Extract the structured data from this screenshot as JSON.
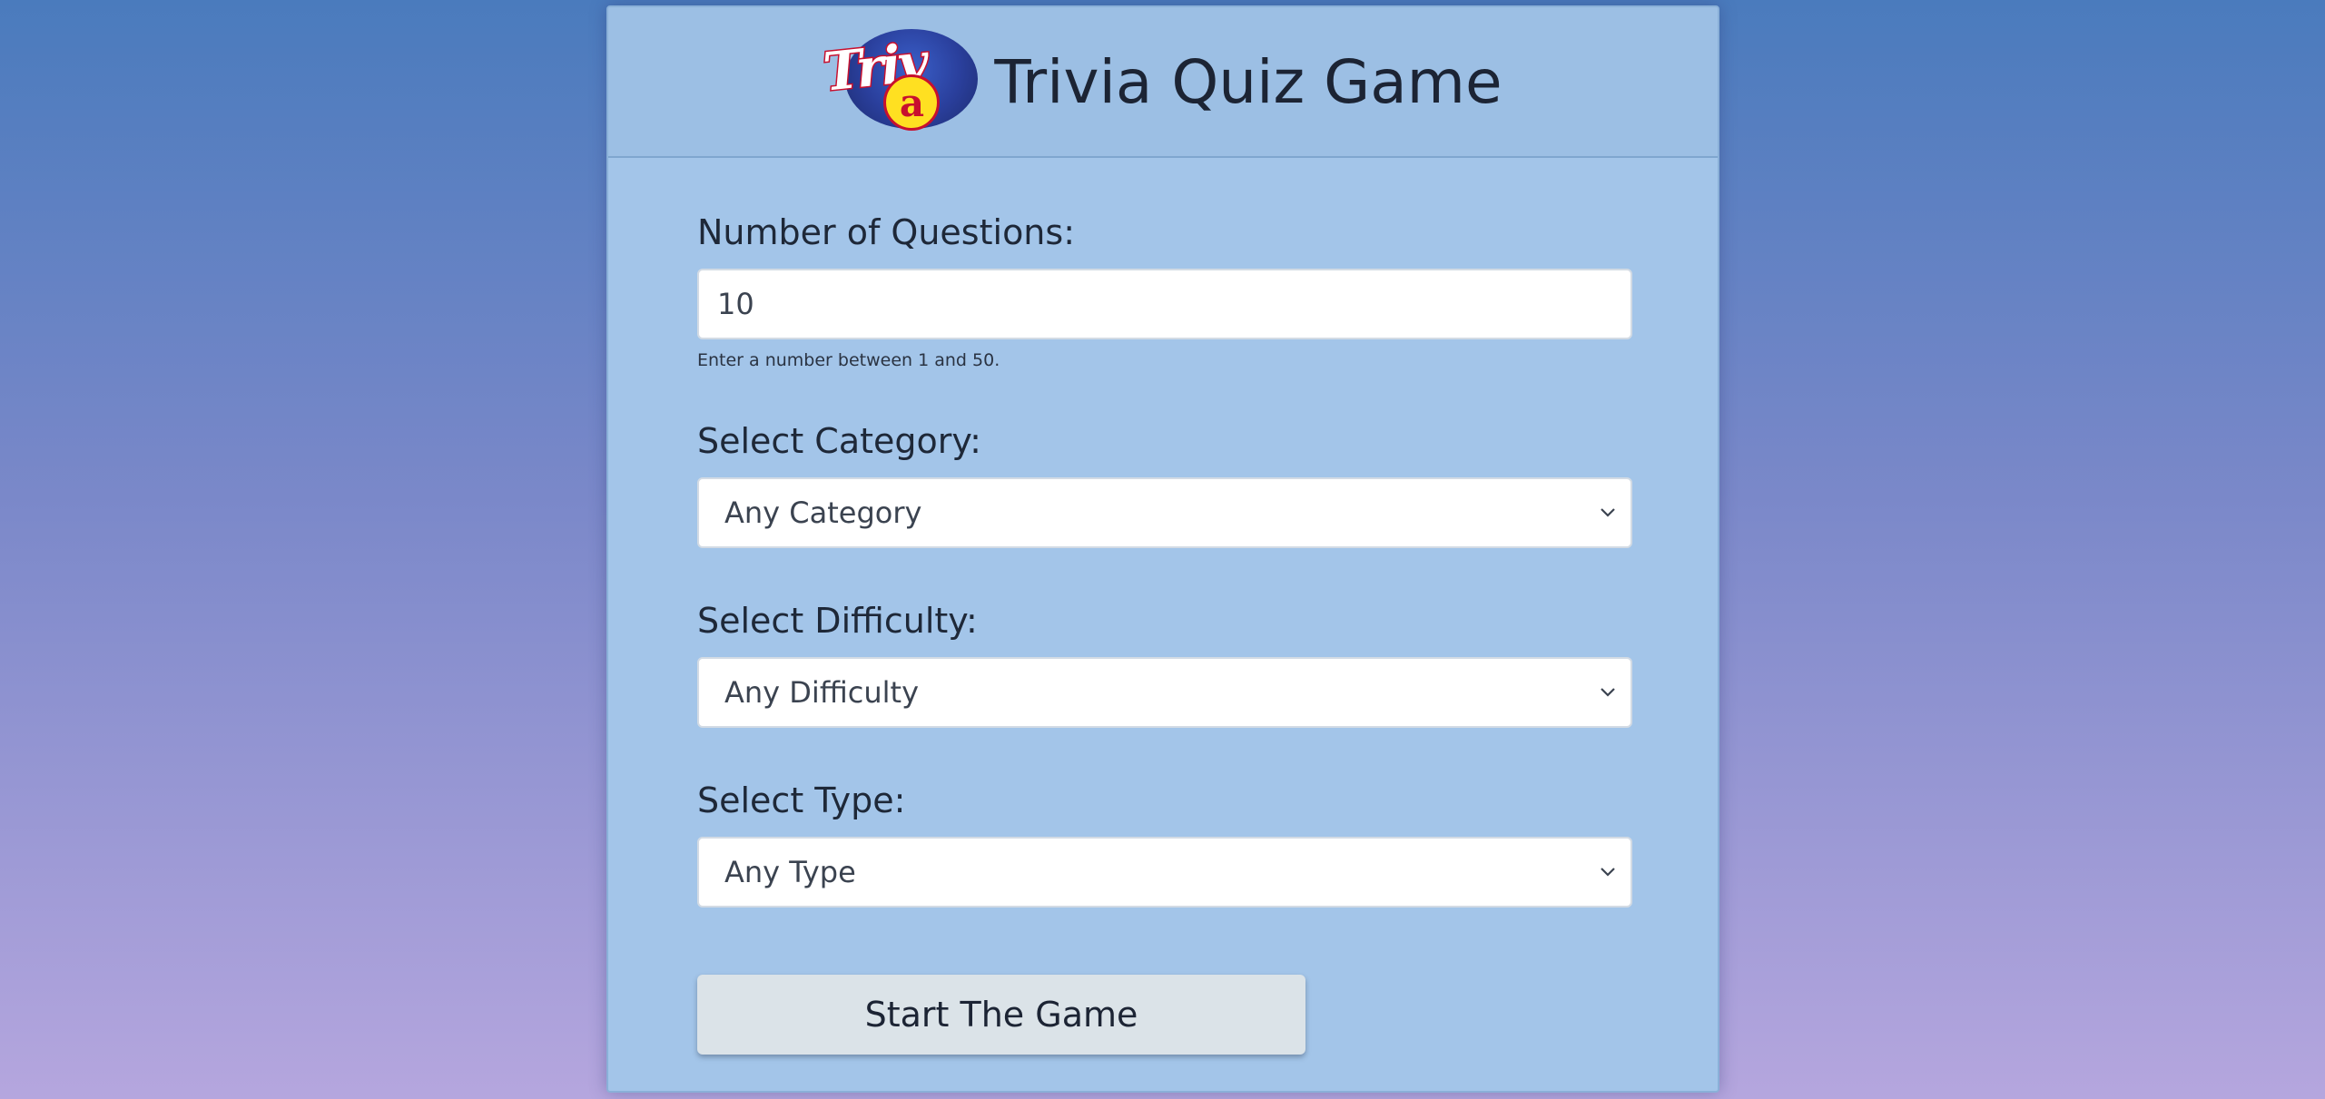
{
  "header": {
    "logo_text": "Triv",
    "logo_letter": "a",
    "logo_icon": "trivia-logo",
    "title": "Trivia Quiz Game"
  },
  "form": {
    "questions": {
      "label": "Number of Questions:",
      "value": "10",
      "help": "Enter a number between 1 and 50."
    },
    "category": {
      "label": "Select Category:",
      "selected": "Any Category"
    },
    "difficulty": {
      "label": "Select Difficulty:",
      "selected": "Any Difficulty"
    },
    "type": {
      "label": "Select Type:",
      "selected": "Any Type"
    },
    "start_label": "Start The Game"
  },
  "colors": {
    "card_bg": "#a3c5e9",
    "header_bg": "#9cbfe4",
    "button_bg": "#dbe3e8",
    "page_gradient_top": "#4a7bbd",
    "page_gradient_bottom": "#b5a6de"
  }
}
